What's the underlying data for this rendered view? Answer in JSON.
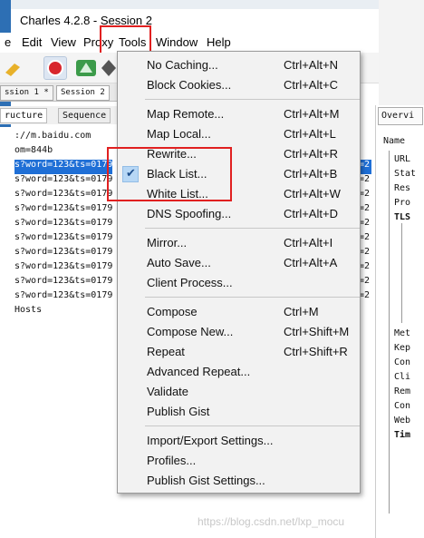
{
  "window": {
    "title": "Charles 4.2.8 - Session 2"
  },
  "menubar": {
    "items": [
      {
        "label": "e"
      },
      {
        "label": "Edit"
      },
      {
        "label": "View"
      },
      {
        "label": "Proxy"
      },
      {
        "label": "Tools"
      },
      {
        "label": "Window"
      },
      {
        "label": "Help"
      }
    ]
  },
  "tabs": {
    "session1": "ssion 1 *",
    "session2": "Session 2"
  },
  "subtabs": {
    "structure": "ructure",
    "sequence": "Sequence"
  },
  "tree": {
    "rows": [
      "://m.baidu.com",
      "om=844b",
      "s?word=123&ts=0179",
      "s?word=123&ts=0179",
      "s?word=123&ts=0179",
      "s?word=123&ts=0179",
      "s?word=123&ts=0179",
      "s?word=123&ts=0179",
      "s?word=123&ts=0179",
      "s?word=123&ts=0179",
      "s?word=123&ts=0179",
      "s?word=123&ts=0179",
      "Hosts"
    ]
  },
  "right_clip": [
    "=2",
    "=2",
    "=2",
    "=2",
    "=2",
    "=2",
    "=2",
    "=2",
    "=2",
    "=2",
    "=2",
    "=2"
  ],
  "right_panel": {
    "tab": "Overvi",
    "rows": [
      "Name",
      "URL",
      "Stat",
      "Res",
      "Pro",
      "TLS",
      "Met",
      "Kep",
      "Con",
      "Cli",
      "Rem",
      "Con",
      "Web",
      "Tim"
    ],
    "top_fragments": [
      "ew",
      "us",
      "on",
      "oc"
    ]
  },
  "tools_menu": {
    "items": [
      {
        "label": "No Caching...",
        "shortcut": "Ctrl+Alt+N"
      },
      {
        "label": "Block Cookies...",
        "shortcut": "Ctrl+Alt+C"
      },
      {
        "label": "Map Remote...",
        "shortcut": "Ctrl+Alt+M"
      },
      {
        "label": "Map Local...",
        "shortcut": "Ctrl+Alt+L"
      },
      {
        "label": "Rewrite...",
        "shortcut": "Ctrl+Alt+R"
      },
      {
        "label": "Black List...",
        "shortcut": "Ctrl+Alt+B",
        "checked": true
      },
      {
        "label": "White List...",
        "shortcut": "Ctrl+Alt+W"
      },
      {
        "label": "DNS Spoofing...",
        "shortcut": "Ctrl+Alt+D"
      },
      {
        "label": "Mirror...",
        "shortcut": "Ctrl+Alt+I"
      },
      {
        "label": "Auto Save...",
        "shortcut": "Ctrl+Alt+A"
      },
      {
        "label": "Client Process...",
        "shortcut": ""
      },
      {
        "label": "Compose",
        "shortcut": "Ctrl+M"
      },
      {
        "label": "Compose New...",
        "shortcut": "Ctrl+Shift+M"
      },
      {
        "label": "Repeat",
        "shortcut": "Ctrl+Shift+R"
      },
      {
        "label": "Advanced Repeat...",
        "shortcut": ""
      },
      {
        "label": "Validate",
        "shortcut": ""
      },
      {
        "label": "Publish Gist",
        "shortcut": ""
      },
      {
        "label": "Import/Export Settings...",
        "shortcut": ""
      },
      {
        "label": "Profiles...",
        "shortcut": ""
      },
      {
        "label": "Publish Gist Settings...",
        "shortcut": ""
      }
    ],
    "check_mark": "✔"
  },
  "watermark": "https://blog.csdn.net/lxp_mocu",
  "colors": {
    "selection": "#1f6fd6",
    "annotation": "#e02020",
    "check_bg": "#b7d7f5"
  },
  "icons": [
    "record-icon",
    "throttle-icon",
    "breakpoint-icon"
  ]
}
